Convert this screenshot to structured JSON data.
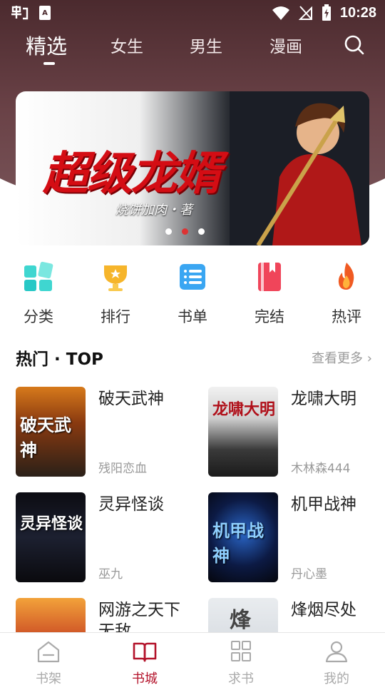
{
  "status_bar": {
    "time": "10:28"
  },
  "top_tabs": [
    {
      "label": "精选",
      "active": true
    },
    {
      "label": "女生",
      "active": false
    },
    {
      "label": "男生",
      "active": false
    },
    {
      "label": "漫画",
      "active": false
    }
  ],
  "banner": {
    "title": "超级龙婿",
    "author": "烧饼加肉・著",
    "page_count": 3,
    "active_page": 2
  },
  "categories": [
    {
      "label": "分类",
      "icon": "grid-icon"
    },
    {
      "label": "排行",
      "icon": "trophy-icon"
    },
    {
      "label": "书单",
      "icon": "list-icon"
    },
    {
      "label": "完结",
      "icon": "book-icon"
    },
    {
      "label": "热评",
      "icon": "flame-icon"
    }
  ],
  "hot_section": {
    "title": "热门 · TOP",
    "more_label": "查看更多"
  },
  "books": [
    {
      "title": "破天武神",
      "author": "残阳恋血",
      "cover_text": "破天武神"
    },
    {
      "title": "龙啸大明",
      "author": "木林森444",
      "cover_text": "龙啸大明"
    },
    {
      "title": "灵异怪谈",
      "author": "巫九",
      "cover_text": "灵异怪谈"
    },
    {
      "title": "机甲战神",
      "author": "丹心墨",
      "cover_text": "机甲战神"
    },
    {
      "title": "网游之天下无敌",
      "author": "",
      "cover_text": ""
    },
    {
      "title": "烽烟尽处",
      "author": "",
      "cover_text": "烽"
    }
  ],
  "bottom_nav": [
    {
      "label": "书架",
      "icon": "bookshelf-icon",
      "active": false
    },
    {
      "label": "书城",
      "icon": "open-book-icon",
      "active": true
    },
    {
      "label": "求书",
      "icon": "apps-icon",
      "active": false
    },
    {
      "label": "我的",
      "icon": "user-icon",
      "active": false
    }
  ],
  "colors": {
    "accent": "#b3122a",
    "hero": "#5b3338",
    "muted": "#999999"
  }
}
